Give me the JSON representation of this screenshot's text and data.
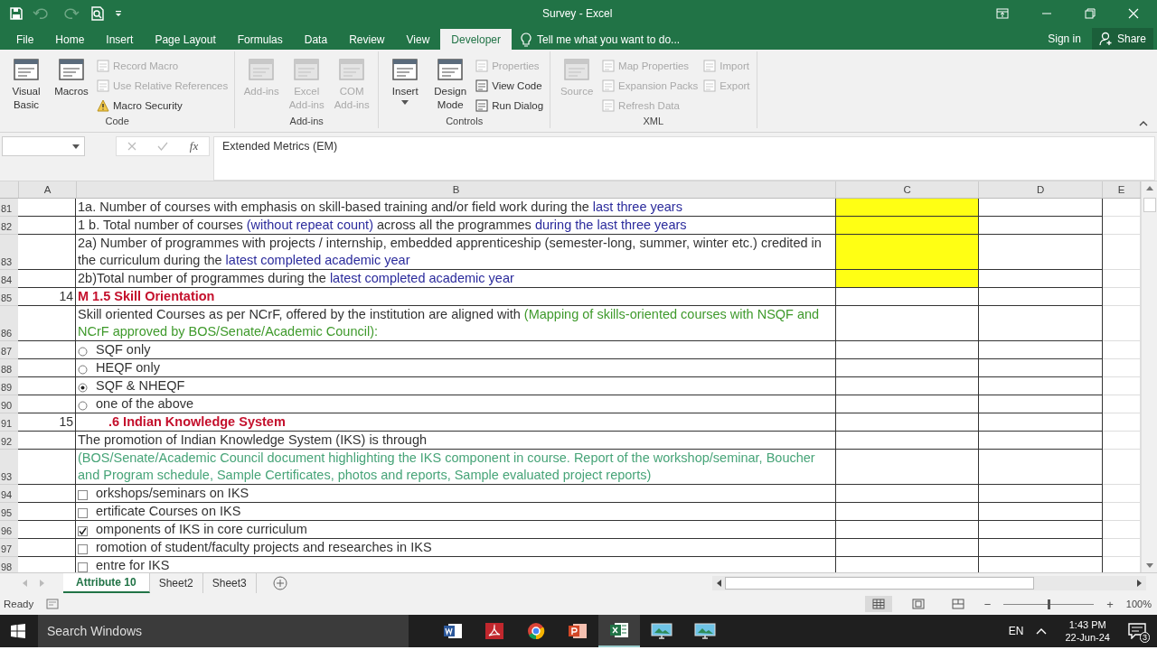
{
  "window": {
    "title": "Survey - Excel"
  },
  "ribbon_tabs": [
    {
      "label": "File",
      "selected": false
    },
    {
      "label": "Home",
      "selected": false
    },
    {
      "label": "Insert",
      "selected": false
    },
    {
      "label": "Page Layout",
      "selected": false
    },
    {
      "label": "Formulas",
      "selected": false
    },
    {
      "label": "Data",
      "selected": false
    },
    {
      "label": "Review",
      "selected": false
    },
    {
      "label": "View",
      "selected": false
    },
    {
      "label": "Developer",
      "selected": true
    }
  ],
  "tell_me": {
    "placeholder": "Tell me what you want to do..."
  },
  "account": {
    "sign_in": "Sign in",
    "share": "Share"
  },
  "ribbon": {
    "groups": [
      {
        "label": "Code",
        "large": [
          {
            "label": "Visual Basic",
            "disabled": false,
            "caret": false
          },
          {
            "label": "Macros",
            "disabled": false,
            "caret": false
          }
        ],
        "columns": [
          [
            {
              "label": "Record Macro",
              "kind": "plain",
              "disabled": true
            },
            {
              "label": "Use Relative References",
              "kind": "plain",
              "disabled": true
            },
            {
              "label": "Macro Security",
              "kind": "warning",
              "disabled": false
            }
          ]
        ]
      },
      {
        "label": "Add-ins",
        "large": [
          {
            "label": "Add-ins",
            "disabled": true,
            "caret": false
          },
          {
            "label": "Excel Add-ins",
            "disabled": true,
            "caret": false
          },
          {
            "label": "COM Add-ins",
            "disabled": true,
            "caret": false
          }
        ]
      },
      {
        "label": "Controls",
        "large": [
          {
            "label": "Insert",
            "disabled": false,
            "caret": true
          },
          {
            "label": "Design Mode",
            "disabled": false,
            "caret": false
          }
        ],
        "columns": [
          [
            {
              "label": "Properties",
              "kind": "plain",
              "disabled": true
            },
            {
              "label": "View Code",
              "kind": "plain",
              "disabled": false
            },
            {
              "label": "Run Dialog",
              "kind": "plain",
              "disabled": false
            }
          ]
        ]
      },
      {
        "label": "XML",
        "large": [
          {
            "label": "Source",
            "disabled": true,
            "caret": false
          }
        ],
        "columns": [
          [
            {
              "label": "Map Properties",
              "kind": "plain",
              "disabled": true
            },
            {
              "label": "Expansion Packs",
              "kind": "plain",
              "disabled": true
            },
            {
              "label": "Refresh Data",
              "kind": "plain",
              "disabled": true
            }
          ],
          [
            {
              "label": "Import",
              "kind": "plain",
              "disabled": true
            },
            {
              "label": "Export",
              "kind": "plain",
              "disabled": true
            }
          ]
        ]
      }
    ]
  },
  "formula_bar": {
    "function_label": "fx",
    "formula": "Extended Metrics (EM)"
  },
  "columns": [
    "A",
    "B",
    "C",
    "D",
    "E"
  ],
  "rows": [
    {
      "number": "81",
      "kind": "text",
      "tall": false,
      "c_highlighted": true,
      "b": [
        {
          "text": "1a. Number of courses with emphasis on skill-based training and/or field work during the ",
          "kind": "plain"
        },
        {
          "text": "last three years",
          "kind": "blue"
        }
      ]
    },
    {
      "number": "82",
      "kind": "text",
      "tall": false,
      "c_highlighted": true,
      "b": [
        {
          "text": "1 b. Total number of courses ",
          "kind": "plain"
        },
        {
          "text": "(without repeat count)",
          "kind": "blue"
        },
        {
          "text": " across all the programmes ",
          "kind": "plain"
        },
        {
          "text": "during the last three years",
          "kind": "blue"
        }
      ]
    },
    {
      "number": "83",
      "kind": "text",
      "tall": true,
      "c_highlighted": true,
      "b": [
        {
          "text": "2a) Number of programmes with projects / internship, embedded apprenticeship (semester-long, summer, winter etc.) credited in the curriculum during the ",
          "kind": "plain"
        },
        {
          "text": "latest completed academic year",
          "kind": "blue"
        }
      ]
    },
    {
      "number": "84",
      "kind": "text",
      "tall": false,
      "c_highlighted": true,
      "b": [
        {
          "text": "2b)Total number of programmes during the ",
          "kind": "plain"
        },
        {
          "text": "latest completed academic year",
          "kind": "blue"
        }
      ]
    },
    {
      "number": "85",
      "kind": "text",
      "tall": false,
      "c_highlighted": false,
      "a": "14",
      "b": [
        {
          "text": "M 1.5 Skill Orientation",
          "kind": "heading"
        }
      ]
    },
    {
      "number": "86",
      "kind": "text",
      "tall": true,
      "c_highlighted": false,
      "b": [
        {
          "text": "Skill oriented Courses as per NCrF, offered by the institution are aligned with ",
          "kind": "plain"
        },
        {
          "text": "(Mapping of skills-oriented courses with NSQF and NCrF approved by BOS/Senate/Academic Council):",
          "kind": "green"
        }
      ]
    },
    {
      "number": "87",
      "kind": "radio",
      "tall": false,
      "c_highlighted": false,
      "selected": false,
      "b": [
        {
          "text": "SQF only",
          "kind": "plain"
        }
      ]
    },
    {
      "number": "88",
      "kind": "radio",
      "tall": false,
      "c_highlighted": false,
      "selected": false,
      "b": [
        {
          "text": "HEQF only",
          "kind": "plain"
        }
      ]
    },
    {
      "number": "89",
      "kind": "radio",
      "tall": false,
      "c_highlighted": false,
      "selected": true,
      "b": [
        {
          "text": "SQF & NHEQF",
          "kind": "plain"
        }
      ]
    },
    {
      "number": "90",
      "kind": "radio",
      "tall": false,
      "c_highlighted": false,
      "selected": false,
      "b": [
        {
          "text": "one of the above",
          "kind": "plain"
        }
      ]
    },
    {
      "number": "91",
      "kind": "cut",
      "tall": false,
      "c_highlighted": false,
      "a": "15",
      "b": [
        {
          "text": ".6 Indian Knowledge System",
          "kind": "heading"
        }
      ]
    },
    {
      "number": "92",
      "kind": "text",
      "tall": false,
      "c_highlighted": false,
      "b": [
        {
          "text": "The promotion of Indian Knowledge System (IKS) is through",
          "kind": "plain"
        }
      ]
    },
    {
      "number": "93",
      "kind": "text",
      "tall": true,
      "c_highlighted": false,
      "b": [
        {
          "text": "(BOS/Senate/Academic Council document highlighting the IKS component in course. Report of the workshop/seminar, Boucher and Program schedule, Sample Certificates, photos and reports, Sample evaluated project reports)",
          "kind": "teal"
        }
      ]
    },
    {
      "number": "94",
      "kind": "checkbox",
      "tall": false,
      "c_highlighted": false,
      "checked": false,
      "b": [
        {
          "text": "orkshops/seminars on IKS",
          "kind": "plain"
        }
      ]
    },
    {
      "number": "95",
      "kind": "checkbox",
      "tall": false,
      "c_highlighted": false,
      "checked": false,
      "b": [
        {
          "text": "ertificate Courses on IKS",
          "kind": "plain"
        }
      ]
    },
    {
      "number": "96",
      "kind": "checkbox",
      "tall": false,
      "c_highlighted": false,
      "checked": true,
      "b": [
        {
          "text": "omponents of IKS in core curriculum",
          "kind": "plain"
        }
      ]
    },
    {
      "number": "97",
      "kind": "checkbox",
      "tall": false,
      "c_highlighted": false,
      "checked": false,
      "b": [
        {
          "text": "romotion of student/faculty projects and researches in IKS",
          "kind": "plain"
        }
      ]
    },
    {
      "number": "98",
      "kind": "checkbox",
      "tall": false,
      "c_highlighted": false,
      "checked": false,
      "b": [
        {
          "text": "entre for IKS",
          "kind": "plain"
        }
      ]
    }
  ],
  "sheet_tabs": [
    {
      "label": "Attribute 10",
      "selected": true
    },
    {
      "label": "Sheet2",
      "selected": false
    },
    {
      "label": "Sheet3",
      "selected": false
    }
  ],
  "status_bar": {
    "status": "Ready",
    "zoom_out": "−",
    "level": 0.5,
    "zoom_in": "+",
    "zoom": "100%"
  },
  "taskbar": {
    "search": {
      "placeholder": "Search Windows"
    },
    "language": "EN",
    "time": "1:43 PM",
    "date": "22-Jun-24",
    "notifications": "3"
  }
}
